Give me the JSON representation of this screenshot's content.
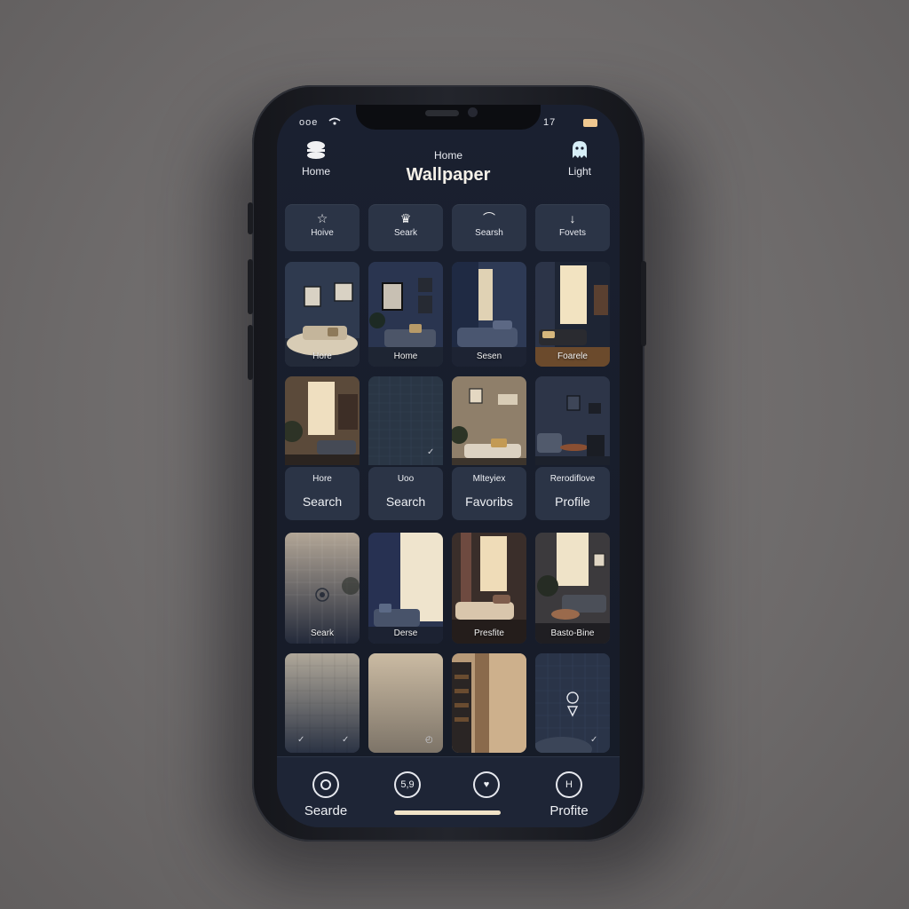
{
  "status": {
    "left": "ooe",
    "right": "17"
  },
  "header": {
    "left_label": "Home",
    "subtitle": "Home",
    "title": "Wallpaper",
    "right_label": "Light"
  },
  "tabs": [
    {
      "label": "Hoive",
      "icon": "star-icon"
    },
    {
      "label": "Seark",
      "icon": "crown-icon"
    },
    {
      "label": "Searsh",
      "icon": "sparkle-icon"
    },
    {
      "label": "Fovets",
      "icon": "download-arrow-icon"
    }
  ],
  "row1": [
    "Hore",
    "Home",
    "Sesen",
    "Foarele"
  ],
  "row2_cards": [
    {
      "top": "Hore",
      "bottom": "Search"
    },
    {
      "top": "Uoo",
      "bottom": "Search"
    },
    {
      "top": "Mlteyiex",
      "bottom": "Favoribs"
    },
    {
      "top": "Rerodiflove",
      "bottom": "Profile"
    }
  ],
  "row3": [
    "Seark",
    "Derse",
    "Presfite",
    "Basto-Bine"
  ],
  "bottom_nav": [
    {
      "label": "Searde",
      "icon": "circle-icon",
      "glyph": ""
    },
    {
      "label": "",
      "icon": "numbers-icon",
      "glyph": "5,9"
    },
    {
      "label": "",
      "icon": "heart-icon",
      "glyph": "♥"
    },
    {
      "label": "Profite",
      "icon": "letter-h-icon",
      "glyph": "H"
    }
  ],
  "colors": {
    "screen_bg": "#161b27",
    "card_bg": "#2b3446",
    "accent_cream": "#f1e3c8"
  }
}
